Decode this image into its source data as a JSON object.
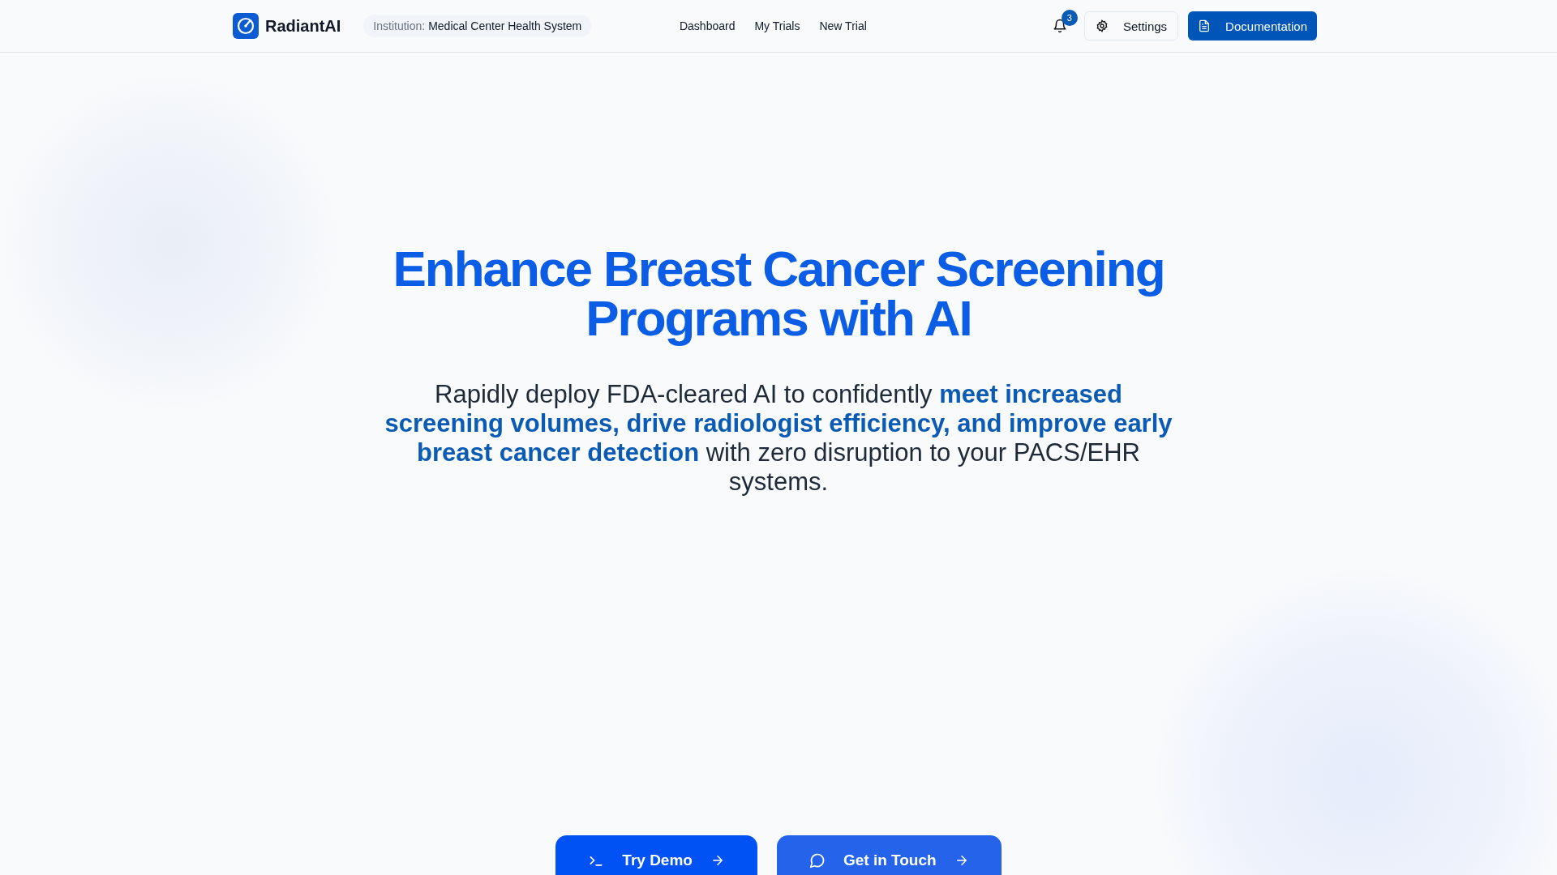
{
  "header": {
    "brand": "RadiantAI",
    "institution": {
      "label": "Institution:",
      "value": "Medical Center Health System"
    },
    "nav": [
      {
        "label": "Dashboard"
      },
      {
        "label": "My Trials"
      },
      {
        "label": "New Trial"
      }
    ],
    "notifications": {
      "count": "3"
    },
    "settings_button": "Settings",
    "documentation_button": "Documentation"
  },
  "hero": {
    "title_lines": [
      "Enhance Breast Cancer Screening",
      "Programs with AI"
    ],
    "subtitle": "Rapidly deploy FDA-cleared AI to confidently **meet increased screening volumes, drive radiologist efficiency, and improve early breast cancer detection** with zero disruption to your PACS/EHR systems.",
    "buttons": [
      {
        "label": "Try Demo",
        "kind": "primary"
      },
      {
        "label": "Get in Touch",
        "kind": "secondary"
      }
    ]
  }
}
